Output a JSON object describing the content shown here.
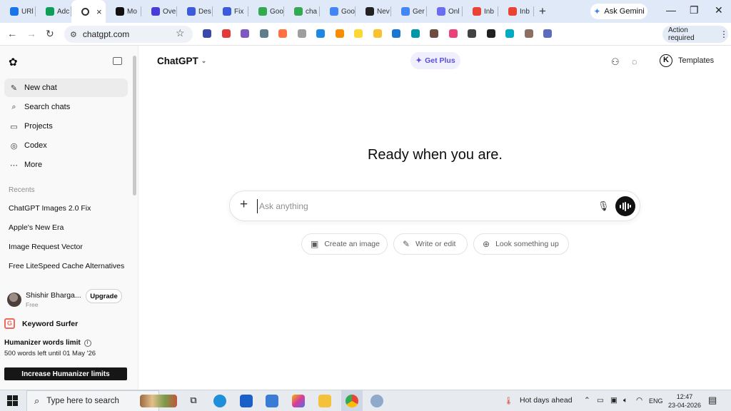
{
  "browser": {
    "tabs": [
      {
        "label": "URl",
        "color": "#1a73e8"
      },
      {
        "label": "Adc",
        "color": "#0f9d58"
      },
      {
        "label": "",
        "color": "#333333",
        "active": true
      },
      {
        "label": "Mo",
        "color": "#111111"
      },
      {
        "label": "Ove",
        "color": "#4b3bd6"
      },
      {
        "label": "Des",
        "color": "#3b5bdb"
      },
      {
        "label": "Fix",
        "color": "#3b5bdb"
      },
      {
        "label": "Goo",
        "color": "#34a853"
      },
      {
        "label": "cha",
        "color": "#34a853"
      },
      {
        "label": "Goo",
        "color": "#4285f4"
      },
      {
        "label": "Nev",
        "color": "#222222"
      },
      {
        "label": "Ger",
        "color": "#4285f4"
      },
      {
        "label": "Onl",
        "color": "#6c6cf0"
      },
      {
        "label": "Inb",
        "color": "#ea4335"
      },
      {
        "label": "Inb",
        "color": "#ea4335"
      }
    ],
    "new_tab": "+",
    "ask_gemini": "Ask Gemini",
    "url": "chatgpt.com",
    "action_required": "Action required",
    "extension_colors": [
      "#3949ab",
      "#e53935",
      "#7e57c2",
      "#607d8b",
      "#ff7043",
      "#9e9e9e",
      "#1e88e5",
      "#fb8c00",
      "#fdd835",
      "#fbc02d",
      "#1976d2",
      "#0097a7",
      "#6d4c41",
      "#ec407a",
      "#424242",
      "#212121",
      "#00acc1",
      "#8d6e63",
      "#5c6bc0"
    ]
  },
  "sidebar": {
    "items": [
      {
        "label": "New chat",
        "icon": "✎",
        "name": "new-chat"
      },
      {
        "label": "Search chats",
        "icon": "⌕",
        "name": "search-chats"
      },
      {
        "label": "Projects",
        "icon": "▭",
        "name": "projects"
      },
      {
        "label": "Codex",
        "icon": "◎",
        "name": "codex"
      },
      {
        "label": "More",
        "icon": "⋯",
        "name": "more"
      }
    ],
    "recents_label": "Recents",
    "recents": [
      "ChatGPT Images 2.0 Fix",
      "Apple's New Era",
      "Image Request Vector",
      "Free LiteSpeed Cache Alternatives"
    ],
    "profile": {
      "name": "Shishir Bharga...",
      "plan": "Free",
      "upgrade": "Upgrade"
    },
    "keyword_surfer": "Keyword Surfer",
    "humanizer": {
      "title": "Humanizer words limit",
      "left": "500 words left until 01 May '26",
      "button": "Increase Humanizer limits"
    }
  },
  "header": {
    "model": "ChatGPT",
    "get_plus": "Get Plus",
    "templates_initial": "K",
    "templates": "Templates"
  },
  "main": {
    "heading": "Ready when you are.",
    "placeholder": "Ask anything",
    "chips": [
      {
        "label": "Create an image",
        "icon": "▣",
        "name": "create-image"
      },
      {
        "label": "Write or edit",
        "icon": "✎",
        "name": "write-edit"
      },
      {
        "label": "Look something up",
        "icon": "⊕",
        "name": "look-up"
      }
    ]
  },
  "taskbar": {
    "search_placeholder": "Type here to search",
    "weather": "Hot days ahead",
    "language": "ENG",
    "time": "12:47",
    "date": "23-04-2026"
  }
}
